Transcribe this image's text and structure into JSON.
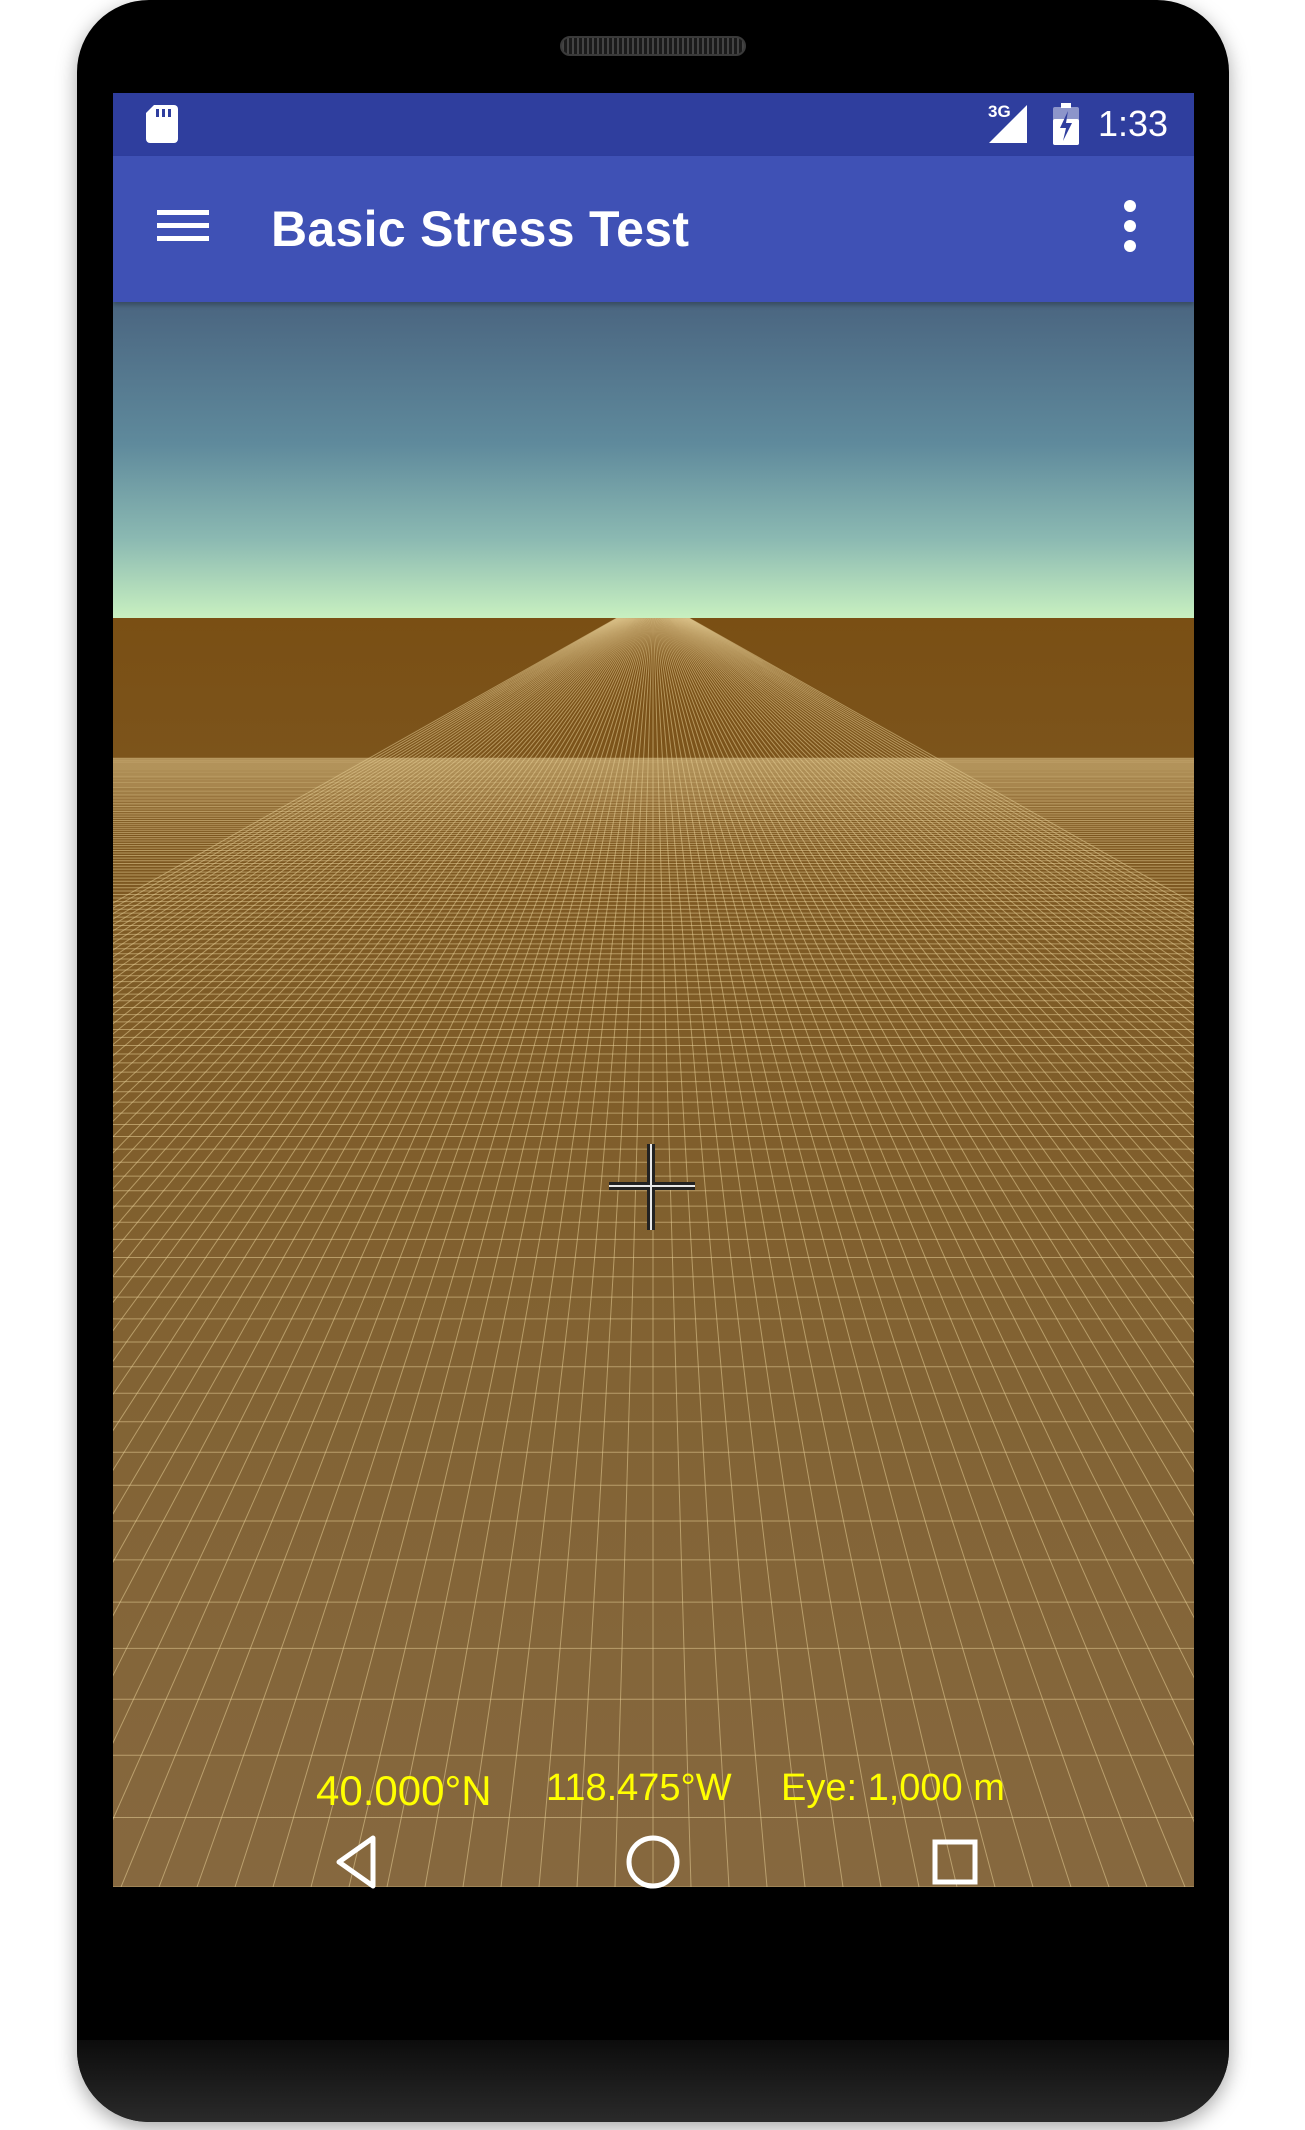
{
  "status_bar": {
    "network_type": "3G",
    "time": "1:33"
  },
  "app_bar": {
    "title": "Basic Stress Test"
  },
  "globe": {
    "latitude": "40.000°N",
    "longitude": "118.475°W",
    "eye_altitude": "Eye: 1,000 m"
  },
  "colors": {
    "status_bar": "#2f3e9e",
    "app_bar": "#3f51b5",
    "coordinate_text": "#ffff00",
    "ground": "#826334",
    "sky_top": "#4a6580",
    "sky_horizon": "#c8f0c0"
  },
  "icons": {
    "status": [
      "sd-card-icon",
      "signal-icon",
      "battery-icon"
    ],
    "app_bar": [
      "menu-icon",
      "overflow-menu-icon"
    ],
    "navigation": [
      "back-icon",
      "home-icon",
      "recents-icon"
    ]
  }
}
